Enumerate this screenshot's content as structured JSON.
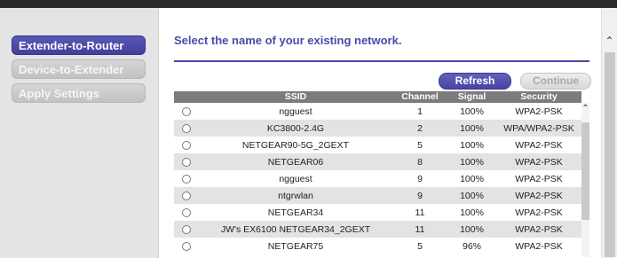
{
  "steps": [
    {
      "label": "Extender-to-Router",
      "active": true
    },
    {
      "label": "Device-to-Extender",
      "active": false
    },
    {
      "label": "Apply Settings",
      "active": false
    }
  ],
  "heading": "Select the name of your existing network.",
  "buttons": {
    "refresh": "Refresh",
    "continue": "Continue"
  },
  "table": {
    "columns": [
      "",
      "SSID",
      "Channel",
      "Signal",
      "Security"
    ],
    "rows": [
      {
        "ssid": "ngguest",
        "channel": "1",
        "signal": "100%",
        "security": "WPA2-PSK"
      },
      {
        "ssid": "KC3800-2.4G",
        "channel": "2",
        "signal": "100%",
        "security": "WPA/WPA2-PSK"
      },
      {
        "ssid": "NETGEAR90-5G_2GEXT",
        "channel": "5",
        "signal": "100%",
        "security": "WPA2-PSK"
      },
      {
        "ssid": "NETGEAR06",
        "channel": "8",
        "signal": "100%",
        "security": "WPA2-PSK"
      },
      {
        "ssid": "ngguest",
        "channel": "9",
        "signal": "100%",
        "security": "WPA2-PSK"
      },
      {
        "ssid": "ntgrwlan",
        "channel": "9",
        "signal": "100%",
        "security": "WPA2-PSK"
      },
      {
        "ssid": "NETGEAR34",
        "channel": "11",
        "signal": "100%",
        "security": "WPA2-PSK"
      },
      {
        "ssid": "JW's EX6100 NETGEAR34_2GEXT",
        "channel": "11",
        "signal": "100%",
        "security": "WPA2-PSK"
      },
      {
        "ssid": "NETGEAR75",
        "channel": "5",
        "signal": "96%",
        "security": "WPA2-PSK"
      }
    ]
  },
  "icons": {
    "scroll_up": "chevron-up-icon",
    "radio": "radio-button-icon"
  },
  "colors": {
    "accent": "#4a4aa8",
    "header_gray": "#7c7c7c",
    "stripe": "#e3e3e3"
  }
}
